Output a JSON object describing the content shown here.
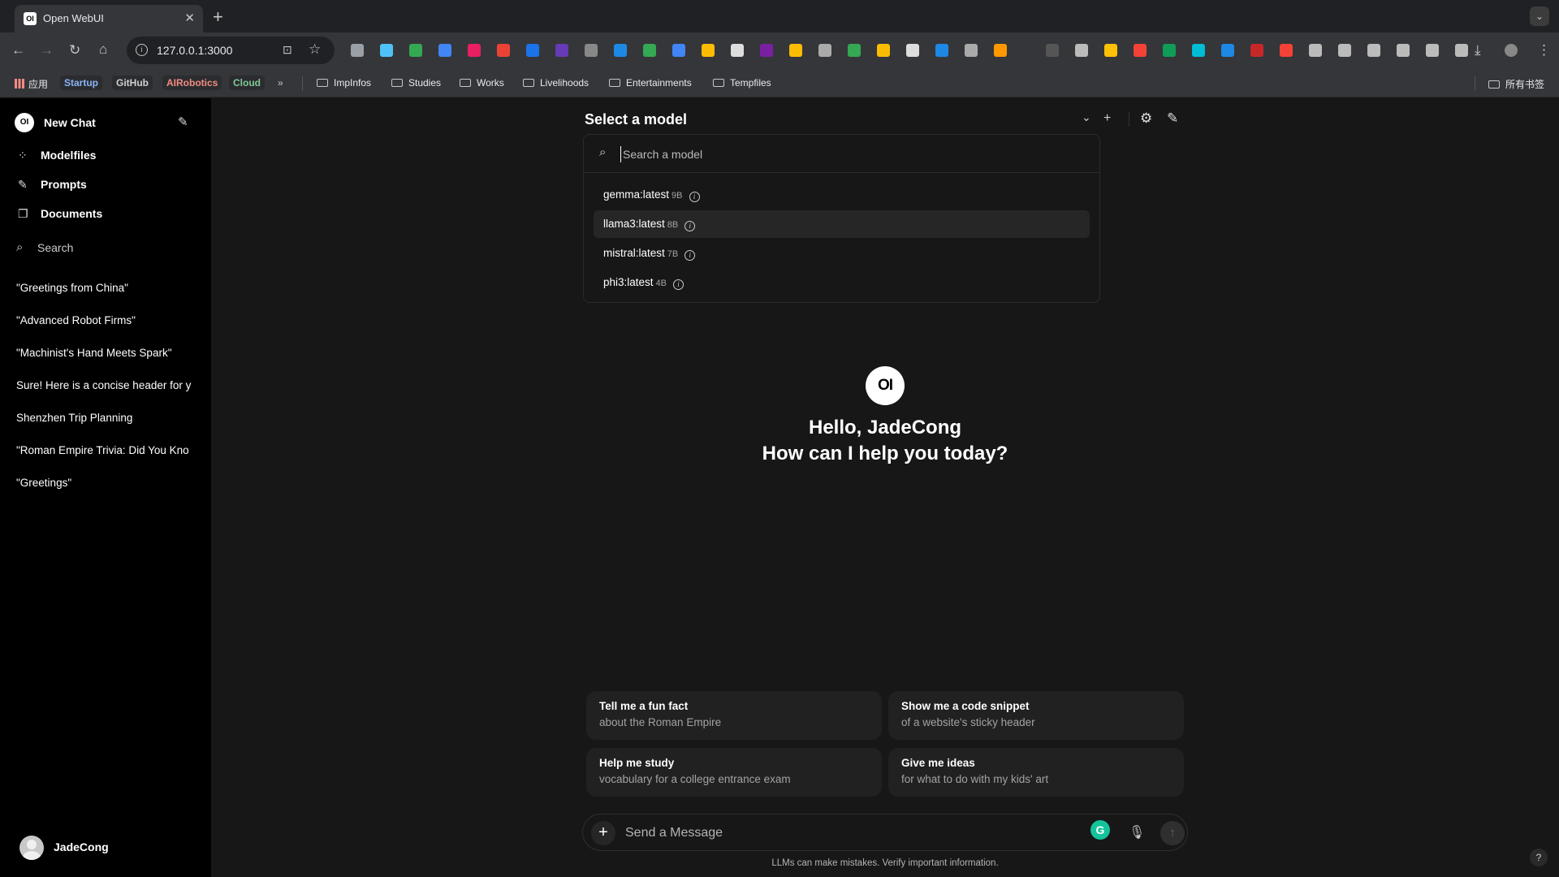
{
  "browser": {
    "tab_title": "Open WebUI",
    "tab_favicon_text": "OI",
    "url": "127.0.0.1:3000",
    "bookmarks_apps_label": "应用",
    "bookmark_pills": [
      {
        "label": "Startup",
        "color": "#8ab4f8"
      },
      {
        "label": "GitHub",
        "color": "#d0d0d0"
      },
      {
        "label": "AIRobotics",
        "color": "#f28b82"
      },
      {
        "label": "Cloud",
        "color": "#81c995"
      }
    ],
    "bookmark_folders": [
      "ImpInfos",
      "Studies",
      "Works",
      "Livelihoods",
      "Entertainments",
      "Tempfiles"
    ],
    "all_bookmarks_label": "所有书签"
  },
  "sidebar": {
    "new_chat": "New Chat",
    "logo_text": "OI",
    "nav": [
      {
        "label": "Modelfiles",
        "icon": "grid-icon"
      },
      {
        "label": "Prompts",
        "icon": "pencil-icon"
      },
      {
        "label": "Documents",
        "icon": "documents-icon"
      }
    ],
    "search_label": "Search",
    "history": [
      "\"Greetings from China\"",
      "\"Advanced Robot Firms\"",
      "\"Machinist's Hand Meets Spark\"",
      "Sure! Here is a concise header for y",
      "Shenzhen Trip Planning",
      "\"Roman Empire Trivia: Did You Kno",
      "\"Greetings\""
    ],
    "user_name": "JadeCong"
  },
  "main": {
    "select_model_title": "Select a model",
    "model_search_placeholder": "Search a model",
    "models": [
      {
        "name": "gemma:latest",
        "size": "9B",
        "active": false
      },
      {
        "name": "llama3:latest",
        "size": "8B",
        "active": true
      },
      {
        "name": "mistral:latest",
        "size": "7B",
        "active": false
      },
      {
        "name": "phi3:latest",
        "size": "4B",
        "active": false
      }
    ],
    "logo_text": "OI",
    "greeting_line1": "Hello, JadeCong",
    "greeting_line2": "How can I help you today?",
    "suggestions": [
      {
        "title": "Tell me a fun fact",
        "subtitle": "about the Roman Empire"
      },
      {
        "title": "Show me a code snippet",
        "subtitle": "of a website's sticky header"
      },
      {
        "title": "Help me study",
        "subtitle": "vocabulary for a college entrance exam"
      },
      {
        "title": "Give me ideas",
        "subtitle": "for what to do with my kids' art"
      }
    ],
    "message_placeholder": "Send a Message",
    "disclaimer": "LLMs can make mistakes. Verify important information.",
    "help_label": "?"
  }
}
